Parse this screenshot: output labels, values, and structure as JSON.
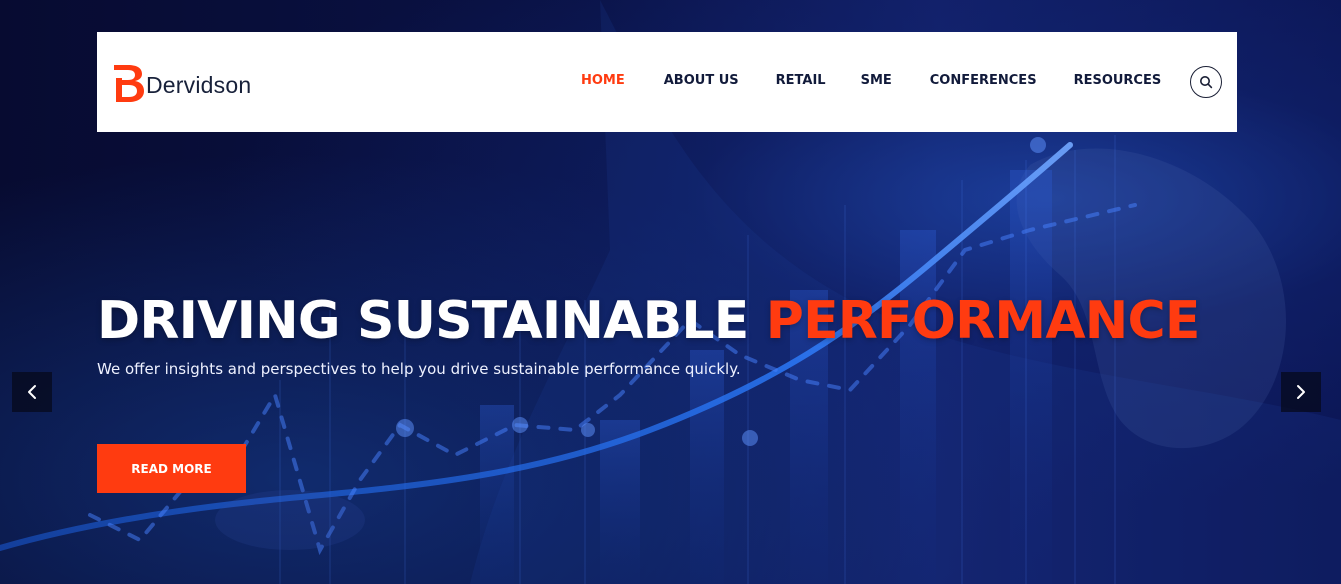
{
  "brand": {
    "name": "Dervidson",
    "mark_icon": "bd-logo-mark",
    "accent_color": "#ff3b10"
  },
  "navigation": {
    "items": [
      {
        "label": "HOME",
        "active": true
      },
      {
        "label": "ABOUT US",
        "active": false
      },
      {
        "label": "RETAIL",
        "active": false
      },
      {
        "label": "SME",
        "active": false
      },
      {
        "label": "CONFERENCES",
        "active": false
      },
      {
        "label": "RESOURCES",
        "active": false
      }
    ],
    "search_icon": "search-icon"
  },
  "hero": {
    "headline_main": "DRIVING SUSTAINABLE ",
    "headline_accent": "PERFORMANCE",
    "subtitle": "We offer insights and perspectives to help you drive sustainable performance quickly.",
    "cta_label": "READ MORE",
    "prev_icon": "chevron-left-icon",
    "next_icon": "chevron-right-icon"
  },
  "colors": {
    "background": "#070b32",
    "navbar": "#ffffff",
    "text_dark": "#111a3a",
    "accent": "#ff3b10"
  }
}
